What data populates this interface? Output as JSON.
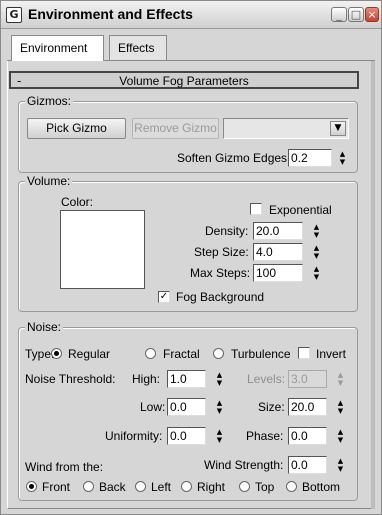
{
  "window": {
    "title": "Environment and Effects",
    "icon": "app-icon",
    "controls": {
      "minimize": "_",
      "maximize": "□",
      "close": "×"
    }
  },
  "tabs": [
    {
      "label": "Environment",
      "active": true
    },
    {
      "label": "Effects",
      "active": false
    }
  ],
  "rollout": {
    "collapse_symbol": "-",
    "title": "Volume Fog Parameters"
  },
  "gizmos": {
    "group_title": "Gizmos:",
    "pick_gizmo": "Pick Gizmo",
    "remove_gizmo": "Remove Gizmo",
    "gizmo_dropdown_value": "",
    "soften_label": "Soften Gizmo Edges:",
    "soften_value": "0.2"
  },
  "volume": {
    "group_title": "Volume:",
    "color_label": "Color:",
    "color_value": "#ffffff",
    "exponential_label": "Exponential",
    "exponential_checked": false,
    "density_label": "Density:",
    "density_value": "20.0",
    "step_size_label": "Step Size:",
    "step_size_value": "4.0",
    "max_steps_label": "Max Steps:",
    "max_steps_value": "100",
    "fog_background_label": "Fog Background",
    "fog_background_checked": true,
    "check_mark": "✓"
  },
  "noise": {
    "group_title": "Noise:",
    "type_label": "Type:",
    "types": [
      "Regular",
      "Fractal",
      "Turbulence"
    ],
    "selected_type": "Regular",
    "invert_label": "Invert",
    "invert_checked": false,
    "threshold_label": "Noise Threshold:",
    "high_label": "High:",
    "high_value": "1.0",
    "levels_label": "Levels:",
    "levels_value": "3.0",
    "low_label": "Low:",
    "low_value": "0.0",
    "size_label": "Size:",
    "size_value": "20.0",
    "uniformity_label": "Uniformity:",
    "uniformity_value": "0.0",
    "phase_label": "Phase:",
    "phase_value": "0.0",
    "wind_from_label": "Wind from the:",
    "wind_strength_label": "Wind Strength:",
    "wind_strength_value": "0.0",
    "wind_directions": [
      "Front",
      "Back",
      "Left",
      "Right",
      "Top",
      "Bottom"
    ],
    "selected_wind": "Front"
  },
  "spinner_arrows": "▲▼"
}
